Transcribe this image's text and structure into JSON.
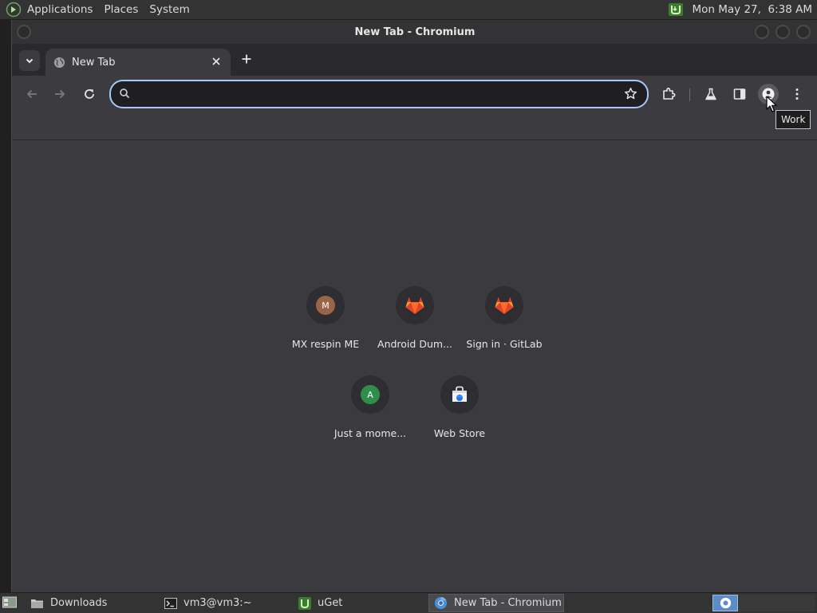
{
  "top_panel": {
    "menus": [
      "Applications",
      "Places",
      "System"
    ],
    "tray_icon": "uget-tray-icon",
    "clock": "Mon May 27,  6:38 AM"
  },
  "window": {
    "title": "New Tab - Chromium"
  },
  "tabs": [
    {
      "label": "New Tab",
      "icon": "globe-icon",
      "active": true
    }
  ],
  "toolbar": {
    "omnibox_value": "",
    "omnibox_placeholder": "",
    "buttons": [
      "back-icon",
      "forward-icon",
      "reload-icon",
      "star-icon",
      "extensions-icon",
      "labs-flask-icon",
      "side-panel-icon",
      "profile-icon",
      "menu-kebab-icon"
    ]
  },
  "tooltip": "Work",
  "shortcuts": [
    {
      "title": "MX respin ME",
      "icon": "letter-avatar",
      "letter": "M",
      "color": "#9a6448"
    },
    {
      "title": "Android Dum...",
      "icon": "gitlab-icon"
    },
    {
      "title": "Sign in · GitLab",
      "icon": "gitlab-icon"
    },
    {
      "title": "Just a mome...",
      "icon": "letter-avatar",
      "letter": "A",
      "color": "#2f8f4a"
    },
    {
      "title": "Web Store",
      "icon": "web-store-icon"
    }
  ],
  "taskbar": {
    "items": [
      {
        "label": "Downloads",
        "icon": "folder-icon",
        "active": false
      },
      {
        "label": "vm3@vm3:~",
        "icon": "terminal-icon",
        "active": false
      },
      {
        "label": "uGet",
        "icon": "uget-icon",
        "active": false
      },
      {
        "label": "New Tab - Chromium",
        "icon": "chromium-icon",
        "active": true
      }
    ]
  },
  "colors": {
    "accent": "#a8c7fa",
    "content_bg": "#3b3b3f",
    "toolbar_bg": "#3c3c40",
    "panel_bg": "#333333"
  }
}
